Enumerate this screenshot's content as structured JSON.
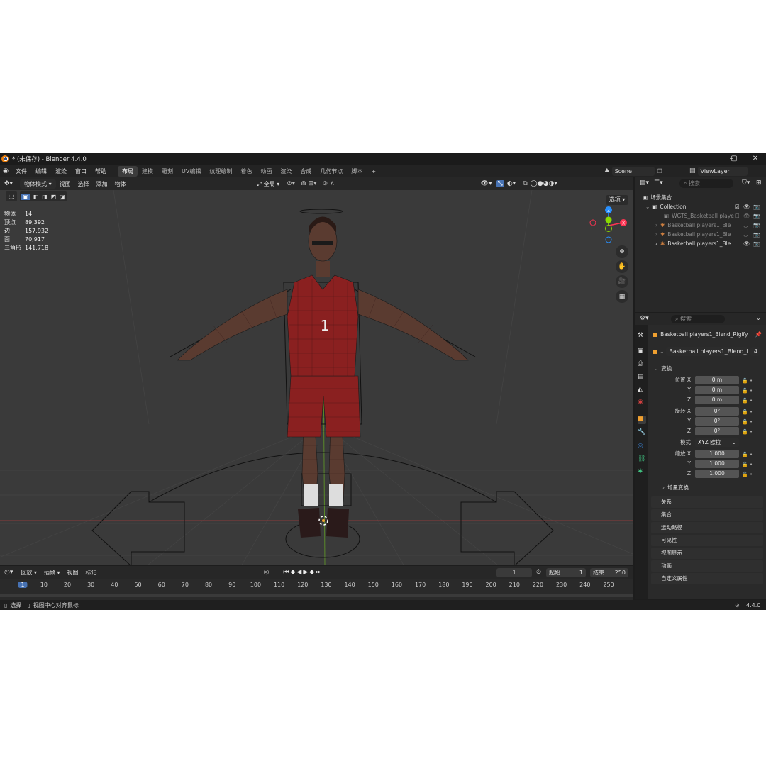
{
  "window": {
    "title": "* (未保存) - Blender 4.4.0"
  },
  "menu": [
    "文件",
    "编辑",
    "渲染",
    "窗口",
    "帮助"
  ],
  "workspaces": [
    "布局",
    "建模",
    "雕刻",
    "UV编辑",
    "纹理绘制",
    "着色",
    "动画",
    "渲染",
    "合成",
    "几何节点",
    "脚本"
  ],
  "scene": {
    "name": "Scene",
    "view_layer": "ViewLayer"
  },
  "viewport_header": {
    "mode": "物体模式",
    "items": [
      "视图",
      "选择",
      "添加",
      "物体"
    ],
    "transform": "全局",
    "options": "选项"
  },
  "stats": [
    {
      "k": "物体",
      "v": "14"
    },
    {
      "k": "顶点",
      "v": "89,392"
    },
    {
      "k": "边",
      "v": "157,932"
    },
    {
      "k": "面",
      "v": "70,917"
    },
    {
      "k": "三角形",
      "v": "141,718"
    }
  ],
  "gizmo": {
    "z": "Z",
    "x": "X"
  },
  "jersey_number": "1",
  "timeline": {
    "items": [
      "回放",
      "插帧",
      "视图",
      "标记"
    ],
    "current": "1",
    "start_label": "起始",
    "start": "1",
    "end_label": "结束",
    "end": "250",
    "ticks": [
      "1",
      "10",
      "20",
      "30",
      "40",
      "50",
      "60",
      "70",
      "80",
      "90",
      "100",
      "110",
      "120",
      "130",
      "140",
      "150",
      "160",
      "170",
      "180",
      "190",
      "200",
      "210",
      "220",
      "230",
      "240",
      "250"
    ]
  },
  "status": {
    "select": "选择",
    "center": "视图中心对齐鼠标",
    "version": "4.4.0"
  },
  "outliner": {
    "search_placeholder": "搜索",
    "root": "场景集合",
    "collection": "Collection",
    "items": [
      "WGTS_Basketball playe",
      "Basketball players1_Ble",
      "Basketball players1_Ble",
      "Basketball players1_Ble"
    ]
  },
  "properties": {
    "search_placeholder": "搜索",
    "object_name": "Basketball players1_Blend_Rigify",
    "data_name": "Basketball players1_Blend_Rig...",
    "users": "4",
    "transform_label": "变换",
    "location_label": "位置 X",
    "y": "Y",
    "z": "Z",
    "location": [
      "0 m",
      "0 m",
      "0 m"
    ],
    "rotation_label": "旋转 X",
    "rotation": [
      "0°",
      "0°",
      "0°"
    ],
    "mode_label": "模式",
    "mode": "XYZ 欧拉",
    "scale_label": "缩放 X",
    "scale": [
      "1.000",
      "1.000",
      "1.000"
    ],
    "delta": "增量变换",
    "panels": [
      "关系",
      "集合",
      "运动路径",
      "可见性",
      "视图显示",
      "动画",
      "自定义属性"
    ]
  },
  "colors": {
    "accent": "#4772b3",
    "x_axis": "#ff3352",
    "y_axis": "#8bdc00",
    "z_axis": "#2890ff",
    "jersey": "#8a2020"
  }
}
